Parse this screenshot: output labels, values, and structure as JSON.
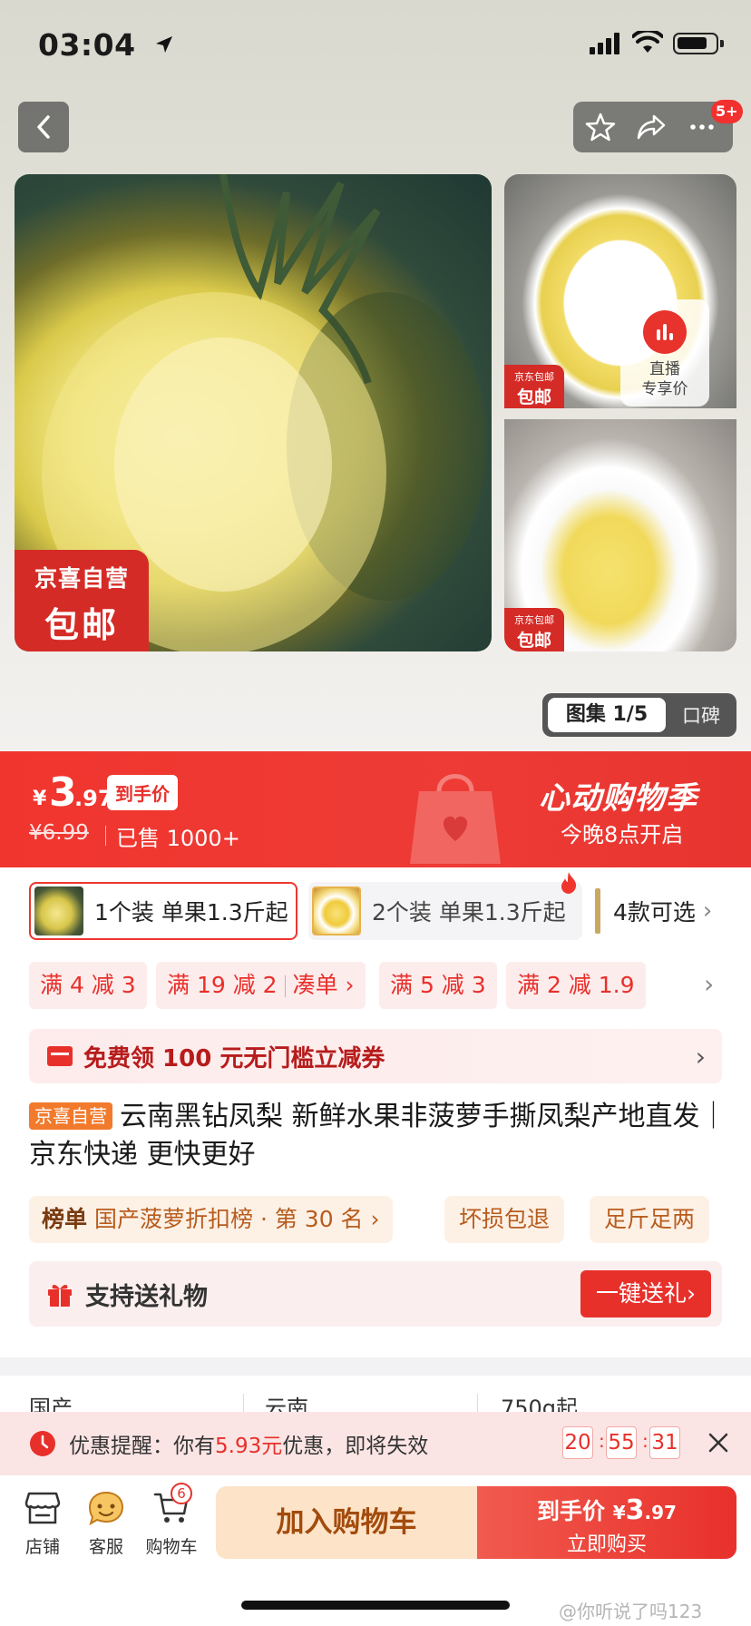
{
  "status_bar": {
    "time": "03:04"
  },
  "header": {
    "more_badge": "5+"
  },
  "gallery": {
    "main_badge_line1": "京喜自营",
    "main_badge_line2": "包邮",
    "small_badge_line1": "京东包邮",
    "small_badge_line2": "包邮",
    "live_line1": "直播",
    "live_line2": "专享价",
    "album_label": "图集 1/5",
    "reviews_label": "口碑"
  },
  "price": {
    "currency": "¥",
    "integer": "3",
    "decimal": ".97",
    "final_label": "到手价",
    "original": "¥6.99",
    "sold": "已售 1000+",
    "promo_title": "心动购物季",
    "promo_sub": "今晚8点开启"
  },
  "variants": [
    {
      "label": "1个装 单果1.3斤起",
      "selected": true
    },
    {
      "label": "2个装 单果1.3斤起",
      "selected": false
    },
    {
      "label": "4款可选"
    }
  ],
  "coupons": [
    {
      "label": "满 4 减 3"
    },
    {
      "label": "满 19 减 2",
      "link": "凑单 ›"
    },
    {
      "label": "满 5 减 3"
    },
    {
      "label": "满 2 减 1.9"
    }
  ],
  "free_coupon": "免费领 100 元无门槛立减券",
  "product": {
    "tag": "京喜自营",
    "title": "云南黑钻凤梨 新鲜水果非菠萝手撕凤梨产地直发｜京东快递 更快更好"
  },
  "rank": {
    "label": "榜单",
    "text": "国产菠萝折扣榜 · 第 30 名 ›"
  },
  "chips": [
    "坏损包退",
    "足斤足两"
  ],
  "gift": {
    "text": "支持送礼物",
    "button": "一键送礼›"
  },
  "attributes": [
    "国产",
    "云南",
    "750g起"
  ],
  "reminder": {
    "prefix": "优惠提醒：你有",
    "amount": "5.93元",
    "suffix": "优惠，即将失效",
    "hours": "20",
    "minutes": "55",
    "seconds": "31"
  },
  "bottom_nav": [
    {
      "label": "店铺",
      "icon": "store-icon"
    },
    {
      "label": "客服",
      "icon": "service-icon"
    },
    {
      "label": "购物车",
      "icon": "cart-icon"
    }
  ],
  "cart_count": "6",
  "add_to_cart": "加入购物车",
  "buy_now": {
    "label": "到手价",
    "currency": "¥",
    "integer": "3",
    "decimal": ".97",
    "sub": "立即购买"
  },
  "watermark": "@你听说了吗123",
  "colors": {
    "accent": "#e8302b",
    "price_bar": "#f0352e",
    "cart_bg": "#fde3c8"
  }
}
